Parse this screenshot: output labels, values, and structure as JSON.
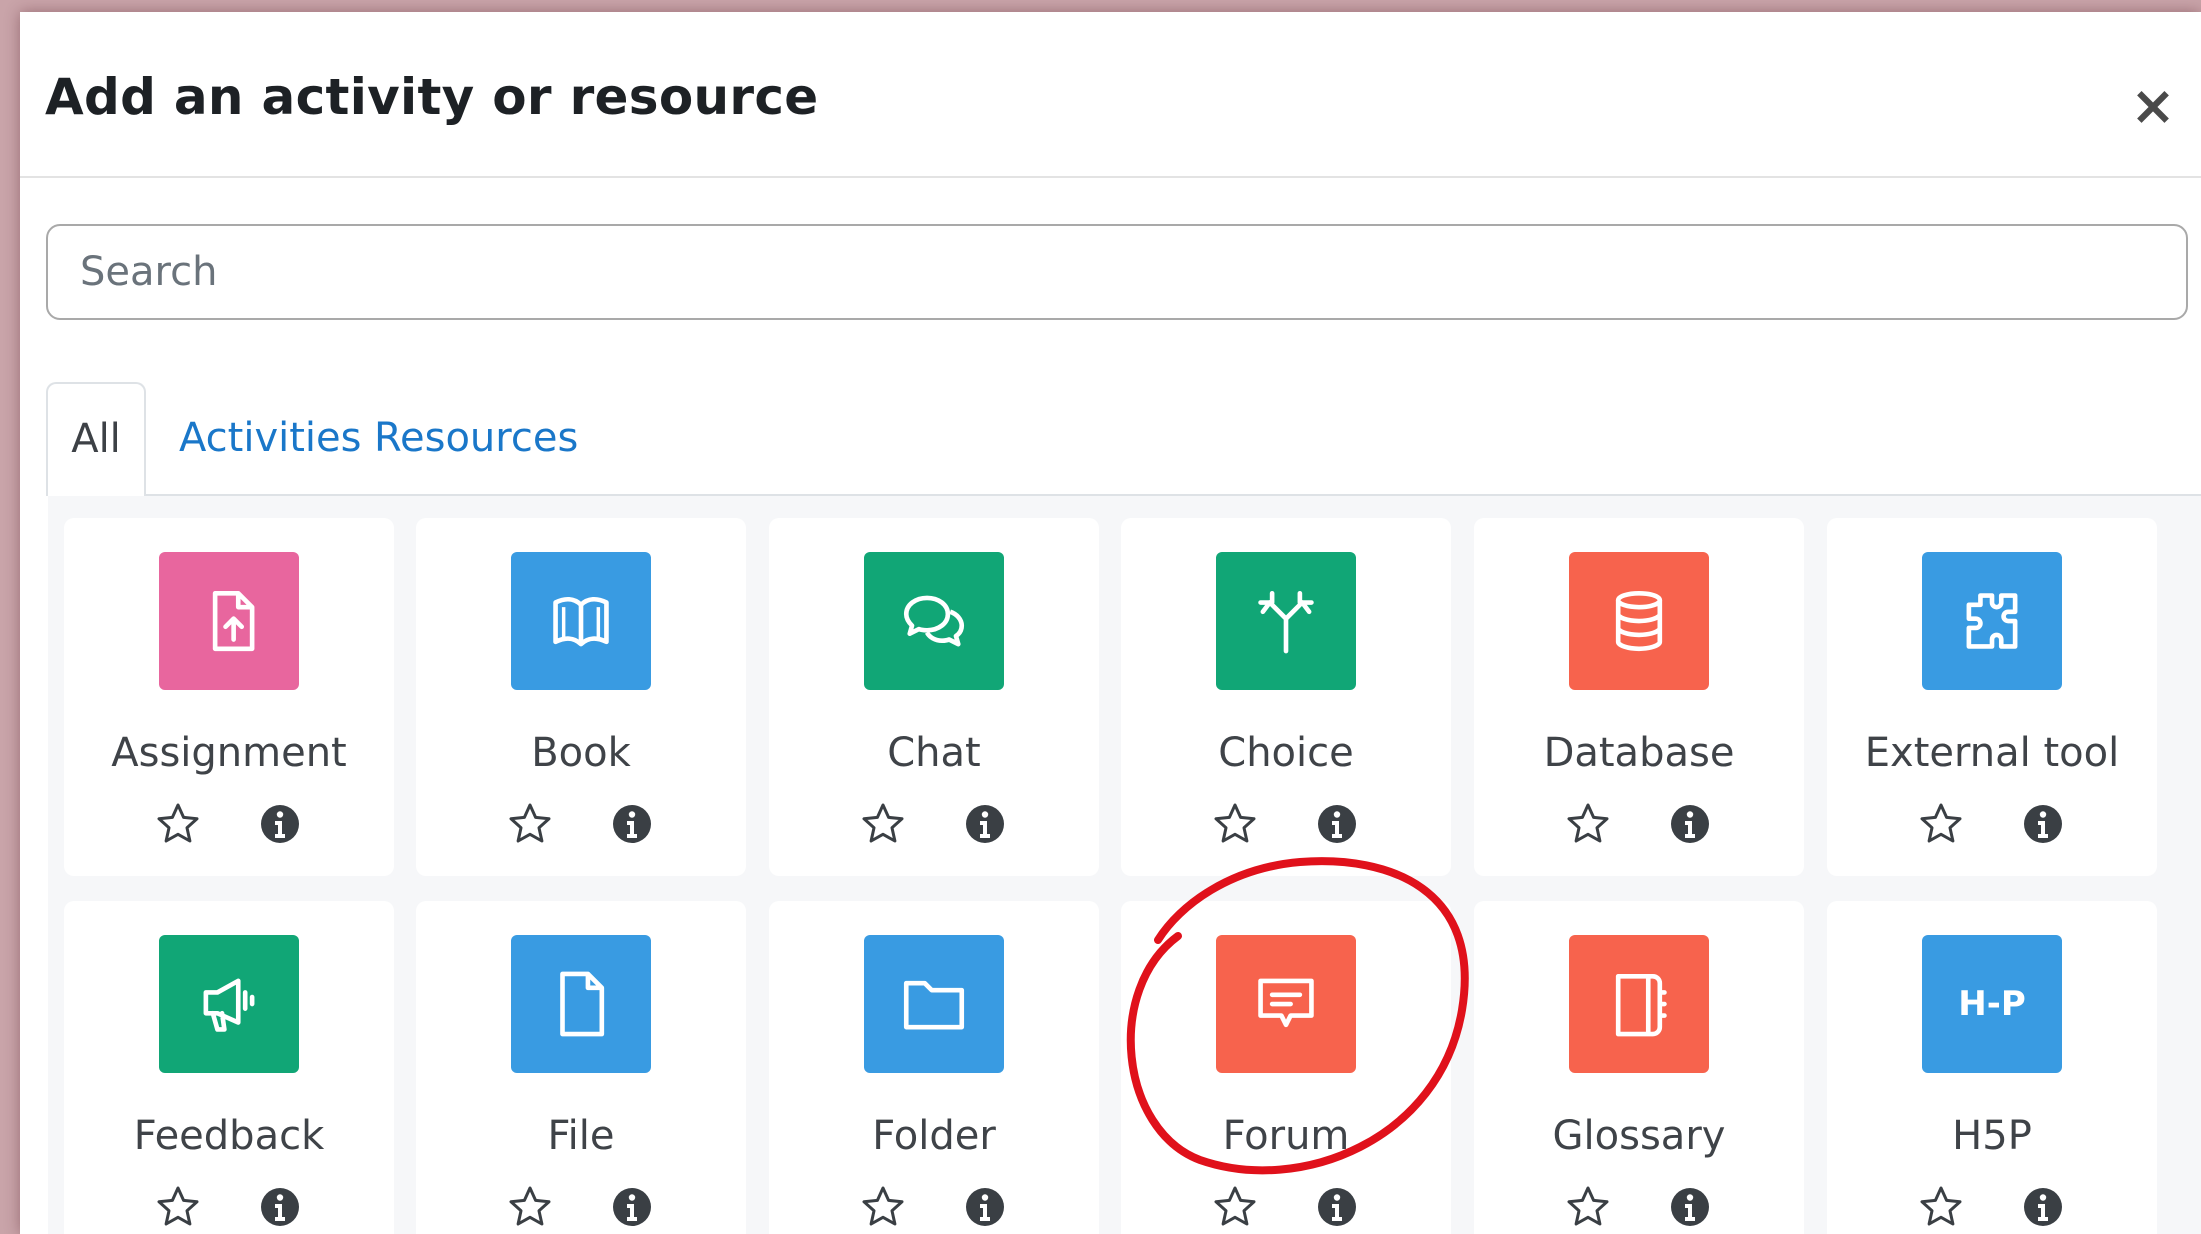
{
  "modal": {
    "title": "Add an activity or resource",
    "close_label": "×"
  },
  "search": {
    "placeholder": "Search",
    "value": ""
  },
  "tabs": [
    {
      "label": "All",
      "active": true
    },
    {
      "label": "Activities",
      "active": false
    },
    {
      "label": "Resources",
      "active": false
    }
  ],
  "tiles": [
    {
      "label": "Assignment",
      "icon": "assignment-icon",
      "color": "#e8669e"
    },
    {
      "label": "Book",
      "icon": "book-icon",
      "color": "#399be2"
    },
    {
      "label": "Chat",
      "icon": "chat-icon",
      "color": "#11a676"
    },
    {
      "label": "Choice",
      "icon": "choice-icon",
      "color": "#11a676"
    },
    {
      "label": "Database",
      "icon": "database-icon",
      "color": "#f7634d"
    },
    {
      "label": "External tool",
      "icon": "external-tool-icon",
      "color": "#399be2"
    },
    {
      "label": "Feedback",
      "icon": "feedback-icon",
      "color": "#11a676"
    },
    {
      "label": "File",
      "icon": "file-icon",
      "color": "#399be2"
    },
    {
      "label": "Folder",
      "icon": "folder-icon",
      "color": "#399be2"
    },
    {
      "label": "Forum",
      "icon": "forum-icon",
      "color": "#f7634d"
    },
    {
      "label": "Glossary",
      "icon": "glossary-icon",
      "color": "#f7634d"
    },
    {
      "label": "H5P",
      "icon": "h5p-icon",
      "color": "#399be2",
      "icon_text": "H-P"
    }
  ],
  "colors": {
    "accent_link": "#1a77c9",
    "annotation_red": "#e0111b"
  }
}
